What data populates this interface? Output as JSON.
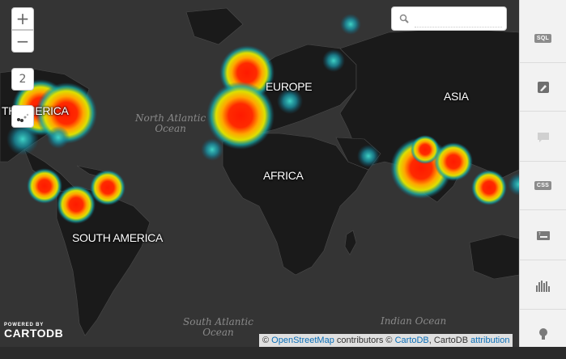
{
  "map": {
    "continents": {
      "north_america_partial": "TH AMERICA",
      "europe": "EUROPE",
      "asia": "ASIA",
      "africa": "AFRICA",
      "south_america": "SOUTH AMERICA"
    },
    "oceans": {
      "north_atlantic": [
        "North Atlantic",
        "Ocean"
      ],
      "south_atlantic": [
        "South Atlantic",
        "Ocean"
      ],
      "indian": [
        "Indian Ocean"
      ]
    }
  },
  "controls": {
    "zoom_in": "+",
    "zoom_out": "−",
    "zoom_level": "2"
  },
  "search": {
    "value": ""
  },
  "sidebar": {
    "items": [
      {
        "name": "sql",
        "label": "SQL"
      },
      {
        "name": "wizard",
        "icon": "paintbrush-icon"
      },
      {
        "name": "infowindow",
        "icon": "speech-bubble-icon"
      },
      {
        "name": "css",
        "label": "CSS"
      },
      {
        "name": "legends",
        "icon": "legend-icon"
      },
      {
        "name": "filters",
        "icon": "histogram-icon"
      },
      {
        "name": "annotation",
        "icon": "pin-icon"
      }
    ]
  },
  "attribution": {
    "prefix": "©",
    "osm": "OpenStreetMap",
    "contrib": "contributors ©",
    "cartodb": "CartoDB",
    "sep": ", CartoDB",
    "attr": "attribution"
  },
  "brand": {
    "powered": "POWERED BY",
    "name": "CARTODB"
  }
}
